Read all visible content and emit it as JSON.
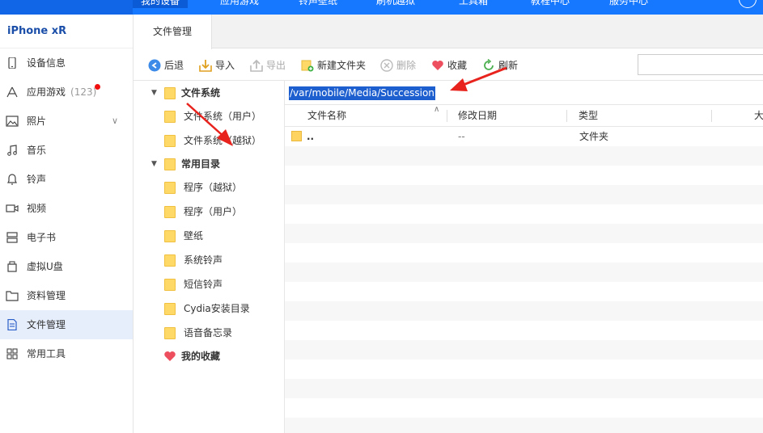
{
  "topnav": {
    "tabs": [
      "我的设备",
      "应用游戏",
      "铃声壁纸",
      "刷机越狱",
      "工具箱",
      "教程中心",
      "服务中心"
    ]
  },
  "sidebar": {
    "device_name": "iPhone xR",
    "items": [
      {
        "label": "设备信息",
        "icon": "phone-icon"
      },
      {
        "label": "应用游戏",
        "icon": "apps-icon",
        "badge": "(123)",
        "has_dot": true
      },
      {
        "label": "照片",
        "icon": "photo-icon",
        "expandable": true
      },
      {
        "label": "音乐",
        "icon": "music-icon"
      },
      {
        "label": "铃声",
        "icon": "bell-icon"
      },
      {
        "label": "视频",
        "icon": "video-icon"
      },
      {
        "label": "电子书",
        "icon": "book-icon"
      },
      {
        "label": "虚拟U盘",
        "icon": "usb-icon"
      },
      {
        "label": "资料管理",
        "icon": "folder-icon"
      },
      {
        "label": "文件管理",
        "icon": "file-icon",
        "active": true
      },
      {
        "label": "常用工具",
        "icon": "grid-icon"
      }
    ]
  },
  "content_tab": {
    "label": "文件管理"
  },
  "toolbar": {
    "back": "后退",
    "import": "导入",
    "export": "导出",
    "new_folder": "新建文件夹",
    "delete": "删除",
    "favorite": "收藏",
    "refresh": "刷新",
    "search_placeholder": ""
  },
  "tree": {
    "items": [
      {
        "label": "文件系统",
        "level": 0,
        "bold": true,
        "expanded": true
      },
      {
        "label": "文件系统（用户）",
        "level": 1
      },
      {
        "label": "文件系统（越狱）",
        "level": 1
      },
      {
        "label": "常用目录",
        "level": 0,
        "bold": true,
        "expanded": true
      },
      {
        "label": "程序（越狱）",
        "level": 1
      },
      {
        "label": "程序（用户）",
        "level": 1
      },
      {
        "label": "壁纸",
        "level": 1
      },
      {
        "label": "系统铃声",
        "level": 1
      },
      {
        "label": "短信铃声",
        "level": 1
      },
      {
        "label": "Cydia安装目录",
        "level": 1
      },
      {
        "label": "语音备忘录",
        "level": 1
      },
      {
        "label": "我的收藏",
        "level": 0,
        "bold": true,
        "favorite": true
      }
    ]
  },
  "path": "/var/mobile/Media/Succession",
  "file_list": {
    "columns": [
      "文件名称",
      "修改日期",
      "类型",
      "大"
    ],
    "rows": [
      {
        "name": "..",
        "modified": "--",
        "type": "文件夹"
      }
    ]
  },
  "colors": {
    "nav_blue": "#1677ff",
    "accent_red": "#f01010",
    "selection_blue": "#1e5fcf"
  }
}
